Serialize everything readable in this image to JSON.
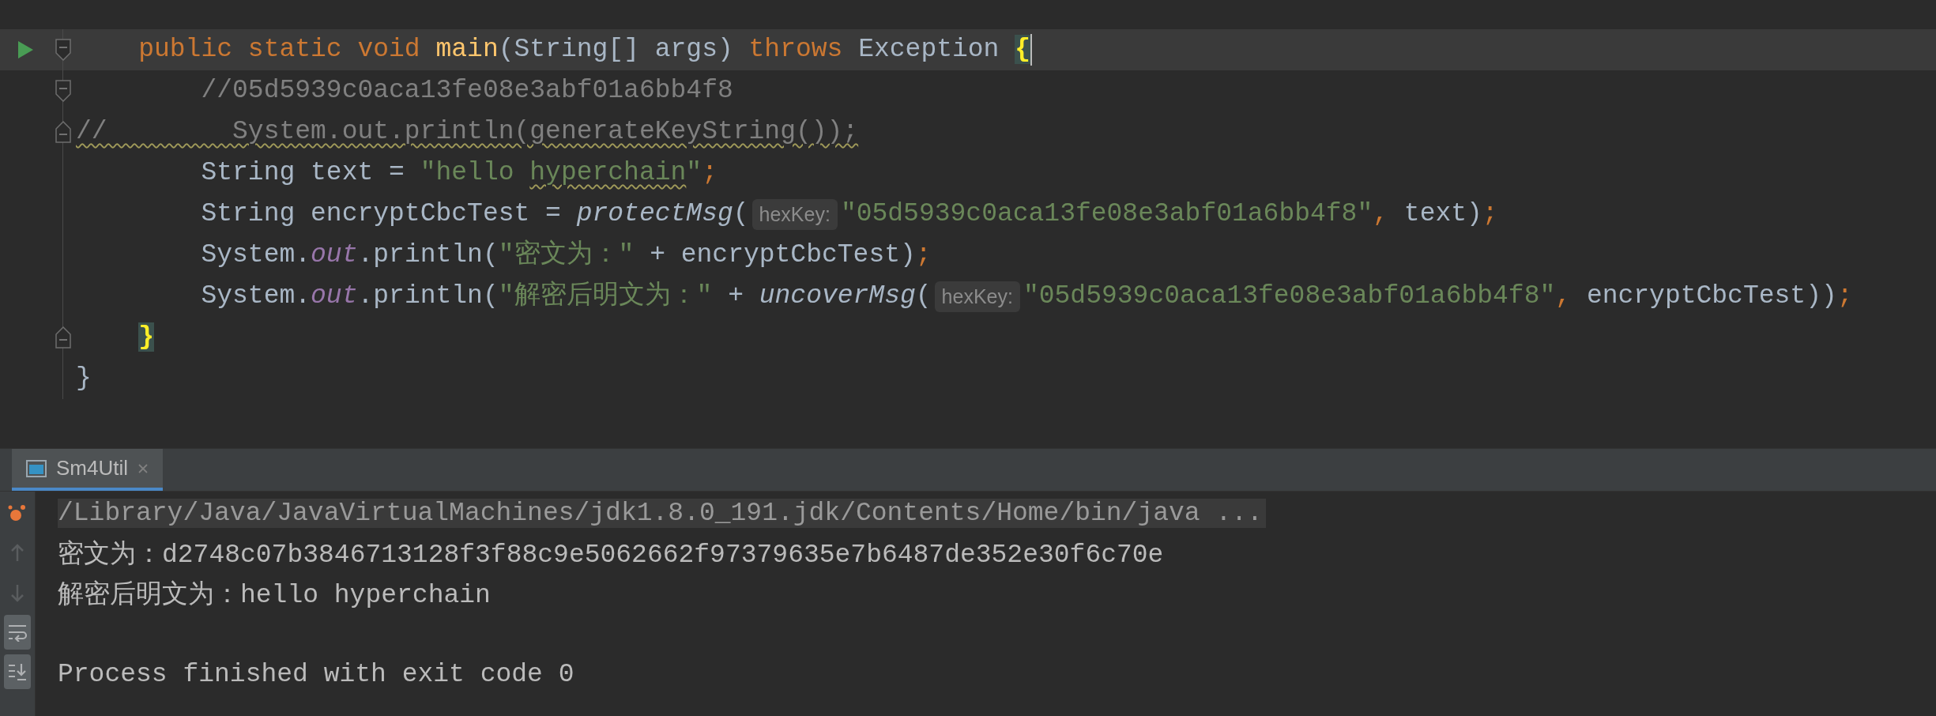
{
  "editor": {
    "lines": [
      {
        "current": true,
        "gutter_icons": [
          {
            "kind": "run"
          },
          {
            "kind": "fold_start"
          }
        ],
        "segments": [
          {
            "kind": "code",
            "tokens": [
              {
                "kind": "keyword",
                "text": "    public static void "
              },
              {
                "kind": "method_decl",
                "text": "main"
              },
              {
                "kind": "plain",
                "text": "(String[] args) "
              },
              {
                "kind": "keyword",
                "text": "throws"
              },
              {
                "kind": "plain",
                "text": " Exception "
              },
              {
                "kind": "brace_match",
                "text": "{"
              }
            ]
          }
        ],
        "caret": true
      },
      {
        "current": false,
        "gutter_icons": [
          {
            "kind": "fold_start"
          }
        ],
        "segments": [
          {
            "kind": "code",
            "tokens": [
              {
                "kind": "comment",
                "text": "        //05d5939c0aca13fe08e3abf01a6bb4f8"
              }
            ]
          }
        ]
      },
      {
        "current": false,
        "gutter_icons": [
          {
            "kind": "fold_end"
          }
        ],
        "segments": [
          {
            "kind": "code",
            "tokens": [
              {
                "kind": "comment",
                "text": "//        System.out.println(generateKeyString());",
                "warning": true
              }
            ]
          }
        ]
      },
      {
        "current": false,
        "segments": [
          {
            "kind": "code",
            "tokens": [
              {
                "kind": "plain",
                "text": "        String text = "
              },
              {
                "kind": "string",
                "text": "\"hello "
              },
              {
                "kind": "string",
                "text": "hyperchain",
                "warning": true
              },
              {
                "kind": "string",
                "text": "\""
              },
              {
                "kind": "punct",
                "text": ";"
              }
            ]
          }
        ]
      },
      {
        "current": false,
        "segments": [
          {
            "kind": "code",
            "tokens": [
              {
                "kind": "plain",
                "text": "        String encryptCbcTest = "
              },
              {
                "kind": "static_method",
                "text": "protectMsg"
              },
              {
                "kind": "plain",
                "text": "("
              }
            ]
          },
          {
            "kind": "hint",
            "text": "hexKey:"
          },
          {
            "kind": "code",
            "tokens": [
              {
                "kind": "string",
                "text": "\"05d5939c0aca13fe08e3abf01a6bb4f8\""
              },
              {
                "kind": "punct",
                "text": ","
              },
              {
                "kind": "plain",
                "text": " text)"
              },
              {
                "kind": "punct",
                "text": ";"
              }
            ]
          }
        ]
      },
      {
        "current": false,
        "segments": [
          {
            "kind": "code",
            "tokens": [
              {
                "kind": "plain",
                "text": "        System."
              },
              {
                "kind": "static_field",
                "text": "out"
              },
              {
                "kind": "plain",
                "text": ".println("
              },
              {
                "kind": "string",
                "text": "\"密文为：\""
              },
              {
                "kind": "plain",
                "text": " + encryptCbcTest)"
              },
              {
                "kind": "punct",
                "text": ";"
              }
            ]
          }
        ]
      },
      {
        "current": false,
        "segments": [
          {
            "kind": "code",
            "tokens": [
              {
                "kind": "plain",
                "text": "        System."
              },
              {
                "kind": "static_field",
                "text": "out"
              },
              {
                "kind": "plain",
                "text": ".println("
              },
              {
                "kind": "string",
                "text": "\"解密后明文为：\""
              },
              {
                "kind": "plain",
                "text": " + "
              },
              {
                "kind": "static_method",
                "text": "uncoverMsg"
              },
              {
                "kind": "plain",
                "text": "("
              }
            ]
          },
          {
            "kind": "hint",
            "text": "hexKey:"
          },
          {
            "kind": "code",
            "tokens": [
              {
                "kind": "string",
                "text": "\"05d5939c0aca13fe08e3abf01a6bb4f8\""
              },
              {
                "kind": "punct",
                "text": ","
              },
              {
                "kind": "plain",
                "text": " encryptCbcTest))"
              },
              {
                "kind": "punct",
                "text": ";"
              }
            ]
          }
        ]
      },
      {
        "current": false,
        "gutter_icons": [
          {
            "kind": "fold_end"
          }
        ],
        "segments": [
          {
            "kind": "code",
            "tokens": [
              {
                "kind": "brace_match",
                "text": "    }"
              }
            ]
          }
        ]
      },
      {
        "current": false,
        "segments": [
          {
            "kind": "code",
            "tokens": [
              {
                "kind": "plain",
                "text": "}"
              }
            ]
          }
        ]
      }
    ]
  },
  "run_panel": {
    "tabs": [
      {
        "label": "Sm4Util",
        "selected": true
      }
    ],
    "toolbar": [
      {
        "kind": "rerun",
        "selected": false,
        "disabled": false
      },
      {
        "kind": "up",
        "selected": false,
        "disabled": true
      },
      {
        "kind": "down",
        "selected": false,
        "disabled": true
      },
      {
        "kind": "wrap",
        "selected": true,
        "disabled": false
      },
      {
        "kind": "scroll_end",
        "selected": true,
        "disabled": false
      }
    ],
    "console": [
      {
        "kind": "command",
        "text": "/Library/Java/JavaVirtualMachines/jdk1.8.0_191.jdk/Contents/Home/bin/java ..."
      },
      {
        "kind": "output",
        "text": "密文为：d2748c07b3846713128f3f88c9e5062662f97379635e7b6487de352e30f6c70e"
      },
      {
        "kind": "output",
        "text": "解密后明文为：hello hyperchain"
      },
      {
        "kind": "blank"
      },
      {
        "kind": "output",
        "text": "Process finished with exit code 0"
      }
    ]
  }
}
